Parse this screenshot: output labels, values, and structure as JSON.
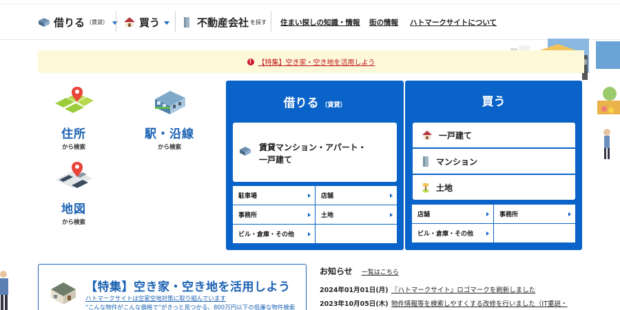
{
  "nav": {
    "rent_label": "借りる",
    "rent_sub": "（賃貸）",
    "buy_label": "買う",
    "company_label": "不動産会社",
    "company_sub": "を探す",
    "knowledge_link": "住まい探しの知識・情報",
    "town_link": "街の情報",
    "about_link": "ハトマークサイトについて"
  },
  "banner": {
    "text": "【特集】空き家・空き地を活用しよう"
  },
  "search": {
    "address": {
      "title": "住所",
      "sub": "から検索"
    },
    "station": {
      "title": "駅・沿線",
      "sub": "から検索"
    },
    "map": {
      "title": "地図",
      "sub": "から検索"
    }
  },
  "rent_panel": {
    "title": "借りる",
    "title_sub": "（賃貸）",
    "main_line1": "賃貸マンション・アパート・",
    "main_line2": "一戸建て",
    "links": [
      "駐車場",
      "店舗",
      "事務所",
      "土地",
      "ビル・倉庫・その他"
    ]
  },
  "buy_panel": {
    "title": "買う",
    "items": [
      "一戸建て",
      "マンション",
      "土地"
    ],
    "links": [
      "店舗",
      "事務所",
      "ビル・倉庫・その他"
    ]
  },
  "feature": {
    "title": "【特集】空き家・空き地を活用しよう",
    "line1": "ハトマークサイトは空家空地対策に取り組んでいます",
    "line2": "\"こんな物件がこんな価格で\"がきっと見つかる、800万円以下の低廉な物件検索"
  },
  "news": {
    "heading": "お知らせ",
    "list_link": "一覧はこちら",
    "items": [
      {
        "date": "2024年01月01日(月)",
        "text": "『ハトマークサイト』ロゴマークを刷新しました"
      },
      {
        "date": "2023年10月05日(木)",
        "text": "物件情報等を検索しやすくする改修を行いました（IT重説・"
      }
    ]
  },
  "colors": {
    "primary": "#0a63c9",
    "accent_red": "#c0161f",
    "banner_bg": "#fdf8d8"
  }
}
